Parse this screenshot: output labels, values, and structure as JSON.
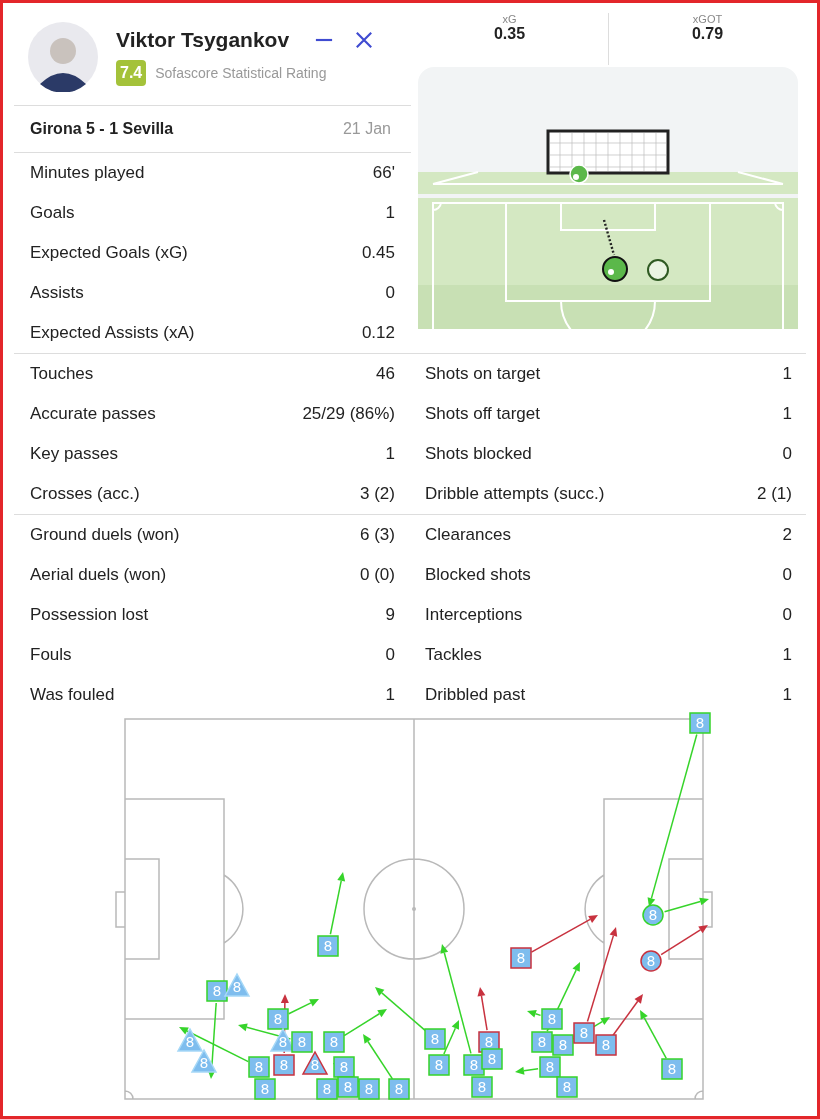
{
  "player": {
    "name": "Viktor Tsygankov",
    "rating": "7.4",
    "rating_label": "Sofascore Statistical Rating"
  },
  "match": {
    "score": "Girona 5 - 1 Sevilla",
    "date": "21 Jan"
  },
  "shot": {
    "metrics": [
      {
        "label": "xG",
        "value": "0.35"
      },
      {
        "label": "xGOT",
        "value": "0.79"
      }
    ]
  },
  "sections": [
    {
      "left": [
        {
          "label": "Minutes played",
          "value": "66'"
        },
        {
          "label": "Goals",
          "value": "1"
        },
        {
          "label": "Expected Goals (xG)",
          "value": "0.45"
        },
        {
          "label": "Assists",
          "value": "0"
        },
        {
          "label": "Expected Assists (xA)",
          "value": "0.12"
        }
      ]
    },
    {
      "left": [
        {
          "label": "Touches",
          "value": "46"
        },
        {
          "label": "Accurate passes",
          "value": "25/29 (86%)"
        },
        {
          "label": "Key passes",
          "value": "1"
        },
        {
          "label": "Crosses (acc.)",
          "value": "3 (2)"
        }
      ],
      "right": [
        {
          "label": "Shots on target",
          "value": "1"
        },
        {
          "label": "Shots off target",
          "value": "1"
        },
        {
          "label": "Shots blocked",
          "value": "0"
        },
        {
          "label": "Dribble attempts (succ.)",
          "value": "2 (1)"
        }
      ]
    },
    {
      "left": [
        {
          "label": "Ground duels (won)",
          "value": "6 (3)"
        },
        {
          "label": "Aerial duels (won)",
          "value": "0 (0)"
        },
        {
          "label": "Possession lost",
          "value": "9"
        },
        {
          "label": "Fouls",
          "value": "0"
        },
        {
          "label": "Was fouled",
          "value": "1"
        }
      ],
      "right": [
        {
          "label": "Clearances",
          "value": "2"
        },
        {
          "label": "Blocked shots",
          "value": "0"
        },
        {
          "label": "Interceptions",
          "value": "0"
        },
        {
          "label": "Tackles",
          "value": "1"
        },
        {
          "label": "Dribbled past",
          "value": "1"
        }
      ]
    }
  ],
  "pass_map": {
    "markers": [
      {
        "label": "8",
        "kind": "square",
        "successful": true
      },
      {
        "label": "8",
        "kind": "circle",
        "successful": true
      },
      {
        "label": "8",
        "kind": "square",
        "successful": true
      },
      {
        "label": "8",
        "kind": "square",
        "successful": false
      },
      {
        "label": "8",
        "kind": "circle",
        "successful": false
      },
      {
        "label": "8",
        "kind": "square",
        "successful": true
      },
      {
        "label": "8",
        "kind": "triangle",
        "successful": true
      },
      {
        "label": "8",
        "kind": "square",
        "successful": true
      },
      {
        "label": "8",
        "kind": "square",
        "successful": true
      },
      {
        "label": "8",
        "kind": "triangle",
        "successful": true
      },
      {
        "label": "8",
        "kind": "triangle",
        "successful": true
      },
      {
        "label": "8",
        "kind": "square",
        "successful": true
      },
      {
        "label": "8",
        "kind": "square",
        "successful": true
      },
      {
        "label": "8",
        "kind": "square",
        "successful": true
      },
      {
        "label": "8",
        "kind": "square",
        "successful": false
      },
      {
        "label": "8",
        "kind": "square",
        "successful": true
      },
      {
        "label": "8",
        "kind": "square",
        "successful": true
      },
      {
        "label": "8",
        "kind": "square",
        "successful": false
      },
      {
        "label": "8",
        "kind": "square",
        "successful": false
      },
      {
        "label": "8",
        "kind": "triangle",
        "successful": true
      },
      {
        "label": "8",
        "kind": "square",
        "successful": true
      },
      {
        "label": "8",
        "kind": "square",
        "successful": false
      },
      {
        "label": "8",
        "kind": "triangle",
        "successful": false
      },
      {
        "label": "8",
        "kind": "square",
        "successful": true
      },
      {
        "label": "8",
        "kind": "square",
        "successful": true
      },
      {
        "label": "8",
        "kind": "square",
        "successful": true
      },
      {
        "label": "8",
        "kind": "square",
        "successful": true
      },
      {
        "label": "8",
        "kind": "square",
        "successful": true
      },
      {
        "label": "8",
        "kind": "square",
        "successful": true
      },
      {
        "label": "8",
        "kind": "square",
        "successful": true
      },
      {
        "label": "8",
        "kind": "square",
        "successful": true
      },
      {
        "label": "8",
        "kind": "square",
        "successful": true
      },
      {
        "label": "8",
        "kind": "square",
        "successful": true
      },
      {
        "label": "8",
        "kind": "square",
        "successful": true
      },
      {
        "label": "8",
        "kind": "square",
        "successful": true
      },
      {
        "label": "8",
        "kind": "square",
        "successful": true
      }
    ]
  }
}
